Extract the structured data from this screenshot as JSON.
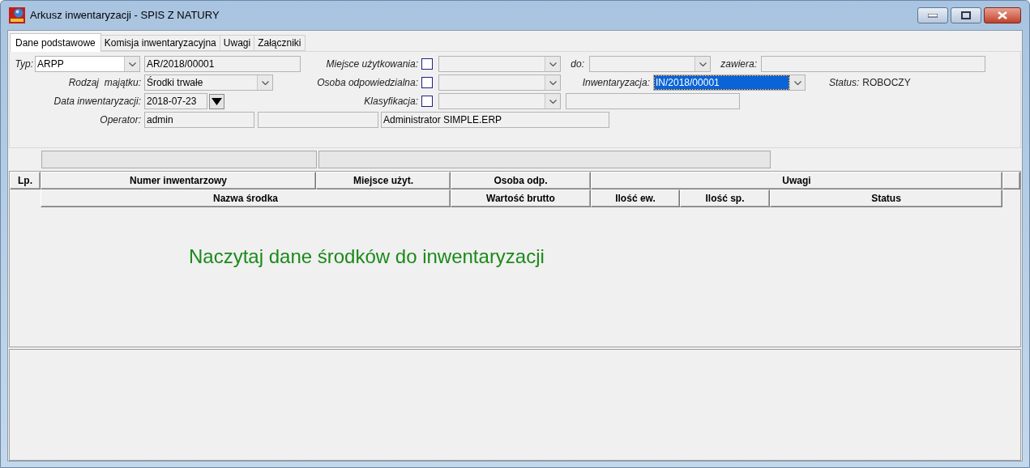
{
  "window": {
    "title": "Arkusz inwentaryzacji - SPIS Z NATURY"
  },
  "tabs": [
    {
      "label": "Dane podstawowe",
      "selected": true
    },
    {
      "label": "Komisja inwentaryzacyjna",
      "selected": false
    },
    {
      "label": "Uwagi",
      "selected": false
    },
    {
      "label": "Załączniki",
      "selected": false
    }
  ],
  "form_rows": [
    [
      {
        "kind": "label",
        "text": "Typ:"
      },
      {
        "kind": "combo",
        "value": "ARPP",
        "editable": true,
        "highlighted": false
      },
      {
        "kind": "field",
        "value": "AR/2018/00001"
      },
      {
        "kind": "label",
        "text": "Miejsce użytkowania:"
      },
      {
        "kind": "checkbox",
        "checked": false
      },
      {
        "kind": "combo",
        "editable": false,
        "highlighted": false
      },
      {
        "kind": "label",
        "text": "do:"
      },
      {
        "kind": "combo",
        "editable": false,
        "highlighted": false
      },
      {
        "kind": "label",
        "text": "zawiera:"
      },
      {
        "kind": "field"
      }
    ],
    [
      {
        "kind": "label",
        "text": "Rodzaj  majątku:"
      },
      {
        "kind": "combo",
        "value": "Środki trwałe",
        "editable": false,
        "highlighted": false
      },
      {
        "kind": "label",
        "text": "Osoba odpowiedzialna:"
      },
      {
        "kind": "checkbox",
        "checked": false
      },
      {
        "kind": "combo",
        "editable": false,
        "highlighted": false
      },
      {
        "kind": "label",
        "text": "Inwentaryzacja:"
      },
      {
        "kind": "combo",
        "value": "IN/2018/00001",
        "editable": false,
        "highlighted": true
      },
      {
        "kind": "label",
        "text": "Status:"
      },
      {
        "kind": "value",
        "text": "ROBOCZY"
      }
    ],
    [
      {
        "kind": "label",
        "text": "Data inwentaryzacji:"
      },
      {
        "kind": "field",
        "value": "2018-07-23"
      },
      {
        "kind": "button"
      },
      {
        "kind": "label",
        "text": "Klasyfikacja:"
      },
      {
        "kind": "checkbox",
        "checked": false
      },
      {
        "kind": "combo",
        "editable": false,
        "highlighted": false
      },
      {
        "kind": "field"
      }
    ],
    [
      {
        "kind": "label",
        "text": "Operator:"
      },
      {
        "kind": "field",
        "value": "admin"
      },
      {
        "kind": "field"
      },
      {
        "kind": "field",
        "value": "Administrator SIMPLE.ERP"
      }
    ]
  ],
  "table": {
    "header_rows": [
      [
        "Lp.",
        "Numer inwentarzowy",
        "Miejsce użyt.",
        "Osoba odp.",
        "Uwagi",
        ""
      ],
      [
        "Nazwa środka",
        "Wartość brutto",
        "Ilość ew.",
        "Ilość sp.",
        "Status"
      ]
    ],
    "empty_message": "Naczytaj dane środków do inwentaryzacji"
  }
}
